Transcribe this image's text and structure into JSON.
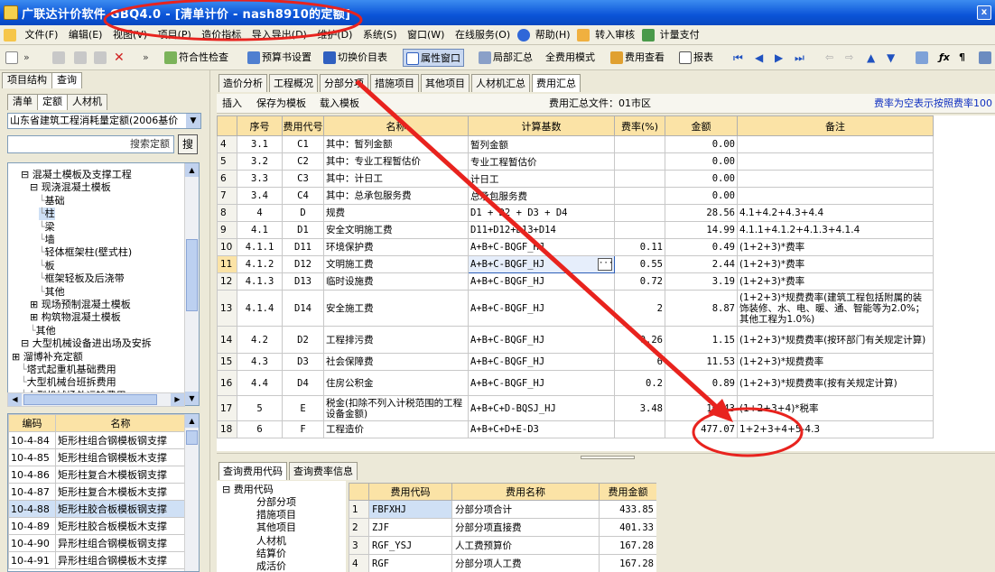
{
  "window": {
    "title": "广联达计价软件 GBQ4.0 - [清单计价 - nash8910的定额]",
    "close_glyph": "x"
  },
  "menu": [
    "文件(F)",
    "编辑(E)",
    "视图(V)",
    "项目(P)",
    "造价指标",
    "导入导出(D)",
    "维护(D)",
    "系统(S)",
    "窗口(W)",
    "在线服务(O)",
    "帮助(H)",
    "转入审核",
    "计量支付"
  ],
  "toolbar": {
    "compliance": "符合性检查",
    "budget_settings": "预算书设置",
    "switch_table": "切换价目表",
    "property_window": "属性窗口",
    "local_summary": "局部汇总",
    "full_mode": "全费用模式",
    "fee_view": "费用查看",
    "report": "报表"
  },
  "left": {
    "tabs": [
      "项目结构",
      "查询"
    ],
    "subtabs": [
      "清单",
      "定额",
      "人材机"
    ],
    "quota_library": "山东省建筑工程消耗量定额(2006基价",
    "search_btn": "搜索定额",
    "search_btn_short": "搜",
    "tree": [
      {
        "label": "混凝土模板及支撑工程",
        "level": 1,
        "expander": "⊟"
      },
      {
        "label": "现浇混凝土模板",
        "level": 2,
        "expander": "⊟"
      },
      {
        "label": "基础",
        "level": 3
      },
      {
        "label": "柱",
        "level": 3,
        "selected": true
      },
      {
        "label": "梁",
        "level": 3
      },
      {
        "label": "墙",
        "level": 3
      },
      {
        "label": "轻体框架柱(壁式柱)",
        "level": 3
      },
      {
        "label": "板",
        "level": 3
      },
      {
        "label": "框架轻板及后浇带",
        "level": 3
      },
      {
        "label": "其他",
        "level": 3
      },
      {
        "label": "现场预制混凝土模板",
        "level": 2,
        "expander": "⊞"
      },
      {
        "label": "构筑物混凝土模板",
        "level": 2,
        "expander": "⊞"
      },
      {
        "label": "其他",
        "level": 2
      },
      {
        "label": "大型机械设备进出场及安拆",
        "level": 1,
        "expander": "⊟"
      },
      {
        "label": "溜博补充定额",
        "level": 0,
        "expander": "⊞"
      },
      {
        "label": "塔式起重机基础费用",
        "level": 1
      },
      {
        "label": "大型机械台班拆费用",
        "level": 1
      },
      {
        "label": "大型机械场外运输费用",
        "level": 1
      }
    ],
    "grid_headers": [
      "编码",
      "名称"
    ],
    "grid_rows": [
      {
        "code": "10-4-84",
        "name": "矩形柱组合钢模板钢支撑"
      },
      {
        "code": "10-4-85",
        "name": "矩形柱组合钢模板木支撑"
      },
      {
        "code": "10-4-86",
        "name": "矩形柱复合木模板钢支撑"
      },
      {
        "code": "10-4-87",
        "name": "矩形柱复合木模板木支撑"
      },
      {
        "code": "10-4-88",
        "name": "矩形柱胶合板模板钢支撑",
        "selected": true
      },
      {
        "code": "10-4-89",
        "name": "矩形柱胶合板模板木支撑"
      },
      {
        "code": "10-4-90",
        "name": "异形柱组合钢模板钢支撑"
      },
      {
        "code": "10-4-91",
        "name": "异形柱组合钢模板木支撑"
      }
    ]
  },
  "main": {
    "tabs": [
      "造价分析",
      "工程概况",
      "分部分项",
      "措施项目",
      "其他项目",
      "人材机汇总",
      "费用汇总"
    ],
    "active_tab": "费用汇总",
    "actions": [
      "插入",
      "保存为模板",
      "载入模板"
    ],
    "file_label": "费用汇总文件：01市区",
    "hint": "费率为空表示按照费率100",
    "headers": [
      "序号",
      "费用代号",
      "名称",
      "计算基数",
      "费率(%)",
      "金额",
      "备注"
    ],
    "rows": [
      {
        "rn": "4",
        "no": "3.1",
        "code": "C1",
        "name": "其中：暂列金额",
        "base": "暂列金额",
        "rate": "",
        "amount": "0.00",
        "note": ""
      },
      {
        "rn": "5",
        "no": "3.2",
        "code": "C2",
        "name": "其中：专业工程暂估价",
        "base": "专业工程暂估价",
        "rate": "",
        "amount": "0.00",
        "note": ""
      },
      {
        "rn": "6",
        "no": "3.3",
        "code": "C3",
        "name": "其中：计日工",
        "base": "计日工",
        "rate": "",
        "amount": "0.00",
        "note": ""
      },
      {
        "rn": "7",
        "no": "3.4",
        "code": "C4",
        "name": "其中：总承包服务费",
        "base": "总承包服务费",
        "rate": "",
        "amount": "0.00",
        "note": ""
      },
      {
        "rn": "8",
        "no": "4",
        "code": "D",
        "name": "规费",
        "base": "D1 + D2 + D3 + D4",
        "rate": "",
        "amount": "28.56",
        "note": "4.1+4.2+4.3+4.4"
      },
      {
        "rn": "9",
        "no": "4.1",
        "code": "D1",
        "name": "安全文明施工费",
        "base": "D11+D12+D13+D14",
        "rate": "",
        "amount": "14.99",
        "note": "4.1.1+4.1.2+4.1.3+4.1.4"
      },
      {
        "rn": "10",
        "no": "4.1.1",
        "code": "D11",
        "name": "环境保护费",
        "base": "A+B+C-BQGF_HJ",
        "rate": "0.11",
        "amount": "0.49",
        "note": "(1+2+3)*费率"
      },
      {
        "rn": "11",
        "no": "4.1.2",
        "code": "D12",
        "name": "文明施工费",
        "base": "A+B+C-BQGF_HJ",
        "rate": "0.55",
        "amount": "2.44",
        "note": "(1+2+3)*费率",
        "current": true
      },
      {
        "rn": "12",
        "no": "4.1.3",
        "code": "D13",
        "name": "临时设施费",
        "base": "A+B+C-BQGF_HJ",
        "rate": "0.72",
        "amount": "3.19",
        "note": "(1+2+3)*费率"
      },
      {
        "rn": "13",
        "no": "4.1.4",
        "code": "D14",
        "name": "安全施工费",
        "base": "A+B+C-BQGF_HJ",
        "rate": "2",
        "amount": "8.87",
        "note": "(1+2+3)*规费费率(建筑工程包括附属的装饰装修、水、电、暖、通、智能等为2.0%；其他工程为1.0%)",
        "tall": 40
      },
      {
        "rn": "14",
        "no": "4.2",
        "code": "D2",
        "name": "工程排污费",
        "base": "A+B+C-BQGF_HJ",
        "rate": "0.26",
        "amount": "1.15",
        "note": "(1+2+3)*规费费率(按环部门有关规定计算)",
        "tall": 30
      },
      {
        "rn": "15",
        "no": "4.3",
        "code": "D3",
        "name": "社会保障费",
        "base": "A+B+C-BQGF_HJ",
        "rate": "6",
        "amount": "11.53",
        "note": "(1+2+3)*规费费率"
      },
      {
        "rn": "16",
        "no": "4.4",
        "code": "D4",
        "name": "住房公积金",
        "base": "A+B+C-BQGF_HJ",
        "rate": "0.2",
        "amount": "0.89",
        "note": "(1+2+3)*规费费率(按有关规定计算)",
        "tall": 28
      },
      {
        "rn": "17",
        "no": "5",
        "code": "E",
        "name": "税金(扣除不列入计税范围的工程设备金额)",
        "base": "A+B+C+D-BQSJ_HJ",
        "rate": "3.48",
        "amount": "16.43",
        "note": "(1+2+3+4)*税率",
        "tall": 28
      },
      {
        "rn": "18",
        "no": "6",
        "code": "F",
        "name": "工程造价",
        "base": "A+B+C+D+E-D3",
        "rate": "",
        "amount": "477.07",
        "note": "1+2+3+4+5-4.3"
      }
    ]
  },
  "bottom": {
    "tabs": [
      "查询费用代码",
      "查询费率信息"
    ],
    "tree_root": "费用代码",
    "tree_items": [
      "分部分项",
      "措施项目",
      "其他项目",
      "人材机",
      "结算价",
      "成活价"
    ],
    "headers": [
      "费用代码",
      "费用名称",
      "费用金额"
    ],
    "rows": [
      {
        "rn": "1",
        "code": "FBFXHJ",
        "name": "分部分项合计",
        "amount": "433.85"
      },
      {
        "rn": "2",
        "code": "ZJF",
        "name": "分部分项直接费",
        "amount": "401.33"
      },
      {
        "rn": "3",
        "code": "RGF_YSJ",
        "name": "人工费预算价",
        "amount": "167.28"
      },
      {
        "rn": "4",
        "code": "RGF",
        "name": "分部分项人工费",
        "amount": "167.28"
      }
    ]
  },
  "annotation": {
    "color": "#e8231e"
  }
}
